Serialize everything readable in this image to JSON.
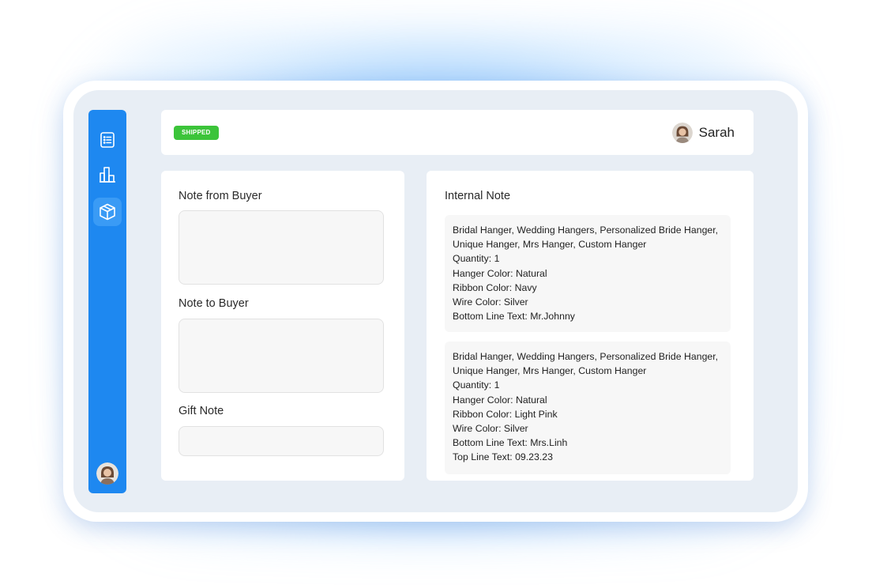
{
  "header": {
    "status_badge": "SHIPPED",
    "user_name": "Sarah"
  },
  "sidebar": {
    "items": [
      {
        "icon": "receipt-list-icon",
        "active": false
      },
      {
        "icon": "bar-chart-icon",
        "active": false
      },
      {
        "icon": "package-box-icon",
        "active": true
      }
    ],
    "avatar": "user-avatar"
  },
  "left_panel": {
    "note_from_buyer_label": "Note from Buyer",
    "note_from_buyer_value": "",
    "note_to_buyer_label": "Note to Buyer",
    "note_to_buyer_value": "",
    "gift_note_label": "Gift Note",
    "gift_note_value": ""
  },
  "internal_note": {
    "title": "Internal Note",
    "entries": [
      {
        "lines": [
          "Bridal Hanger, Wedding Hangers, Personalized Bride Hanger,",
          "Unique Hanger, Mrs Hanger, Custom Hanger",
          "Quantity: 1",
          "Hanger Color: Natural",
          "Ribbon Color: Navy",
          "Wire Color: Silver",
          "Bottom Line Text: Mr.Johnny"
        ]
      },
      {
        "lines": [
          "Bridal Hanger, Wedding Hangers, Personalized Bride Hanger,",
          "Unique Hanger, Mrs Hanger, Custom Hanger",
          "Quantity: 1",
          "Hanger Color: Natural",
          "Ribbon Color: Light Pink",
          "Wire Color: Silver",
          "Bottom Line Text: Mrs.Linh",
          "Top Line Text: 09.23.23"
        ]
      }
    ]
  },
  "colors": {
    "sidebar": "#1e88f0",
    "badge": "#3cc43a",
    "background_panel": "#e8eef5"
  }
}
